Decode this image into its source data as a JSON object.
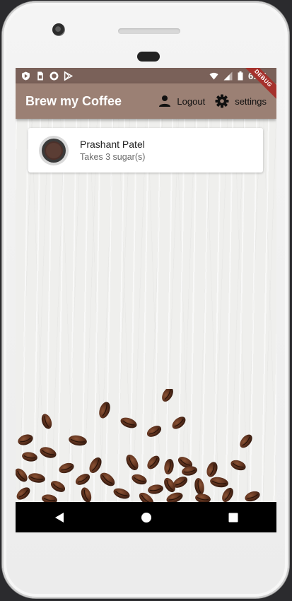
{
  "app": {
    "title": "Brew my Coffee",
    "debug_banner": "DEBUG"
  },
  "statusbar": {
    "time": "6:04",
    "left_icons": [
      "shield-icon",
      "sim-card-icon",
      "record-icon",
      "play-store-icon"
    ],
    "right_icons": [
      "wifi-icon",
      "signal-icon",
      "battery-icon"
    ]
  },
  "appbar": {
    "logout": {
      "icon": "person-icon",
      "label": "Logout"
    },
    "settings": {
      "icon": "gear-icon",
      "label": "settings"
    }
  },
  "brews": [
    {
      "name": "Prashant Patel",
      "subtitle": "Takes 3 sugar(s)"
    }
  ],
  "navbar": {
    "buttons": [
      "back-icon",
      "home-icon",
      "recents-icon"
    ]
  },
  "colors": {
    "statusbar": "#7a6159",
    "appbar": "#9b8074",
    "background": "#efefed",
    "card": "#ffffff",
    "coffee": "#5b3d34"
  }
}
